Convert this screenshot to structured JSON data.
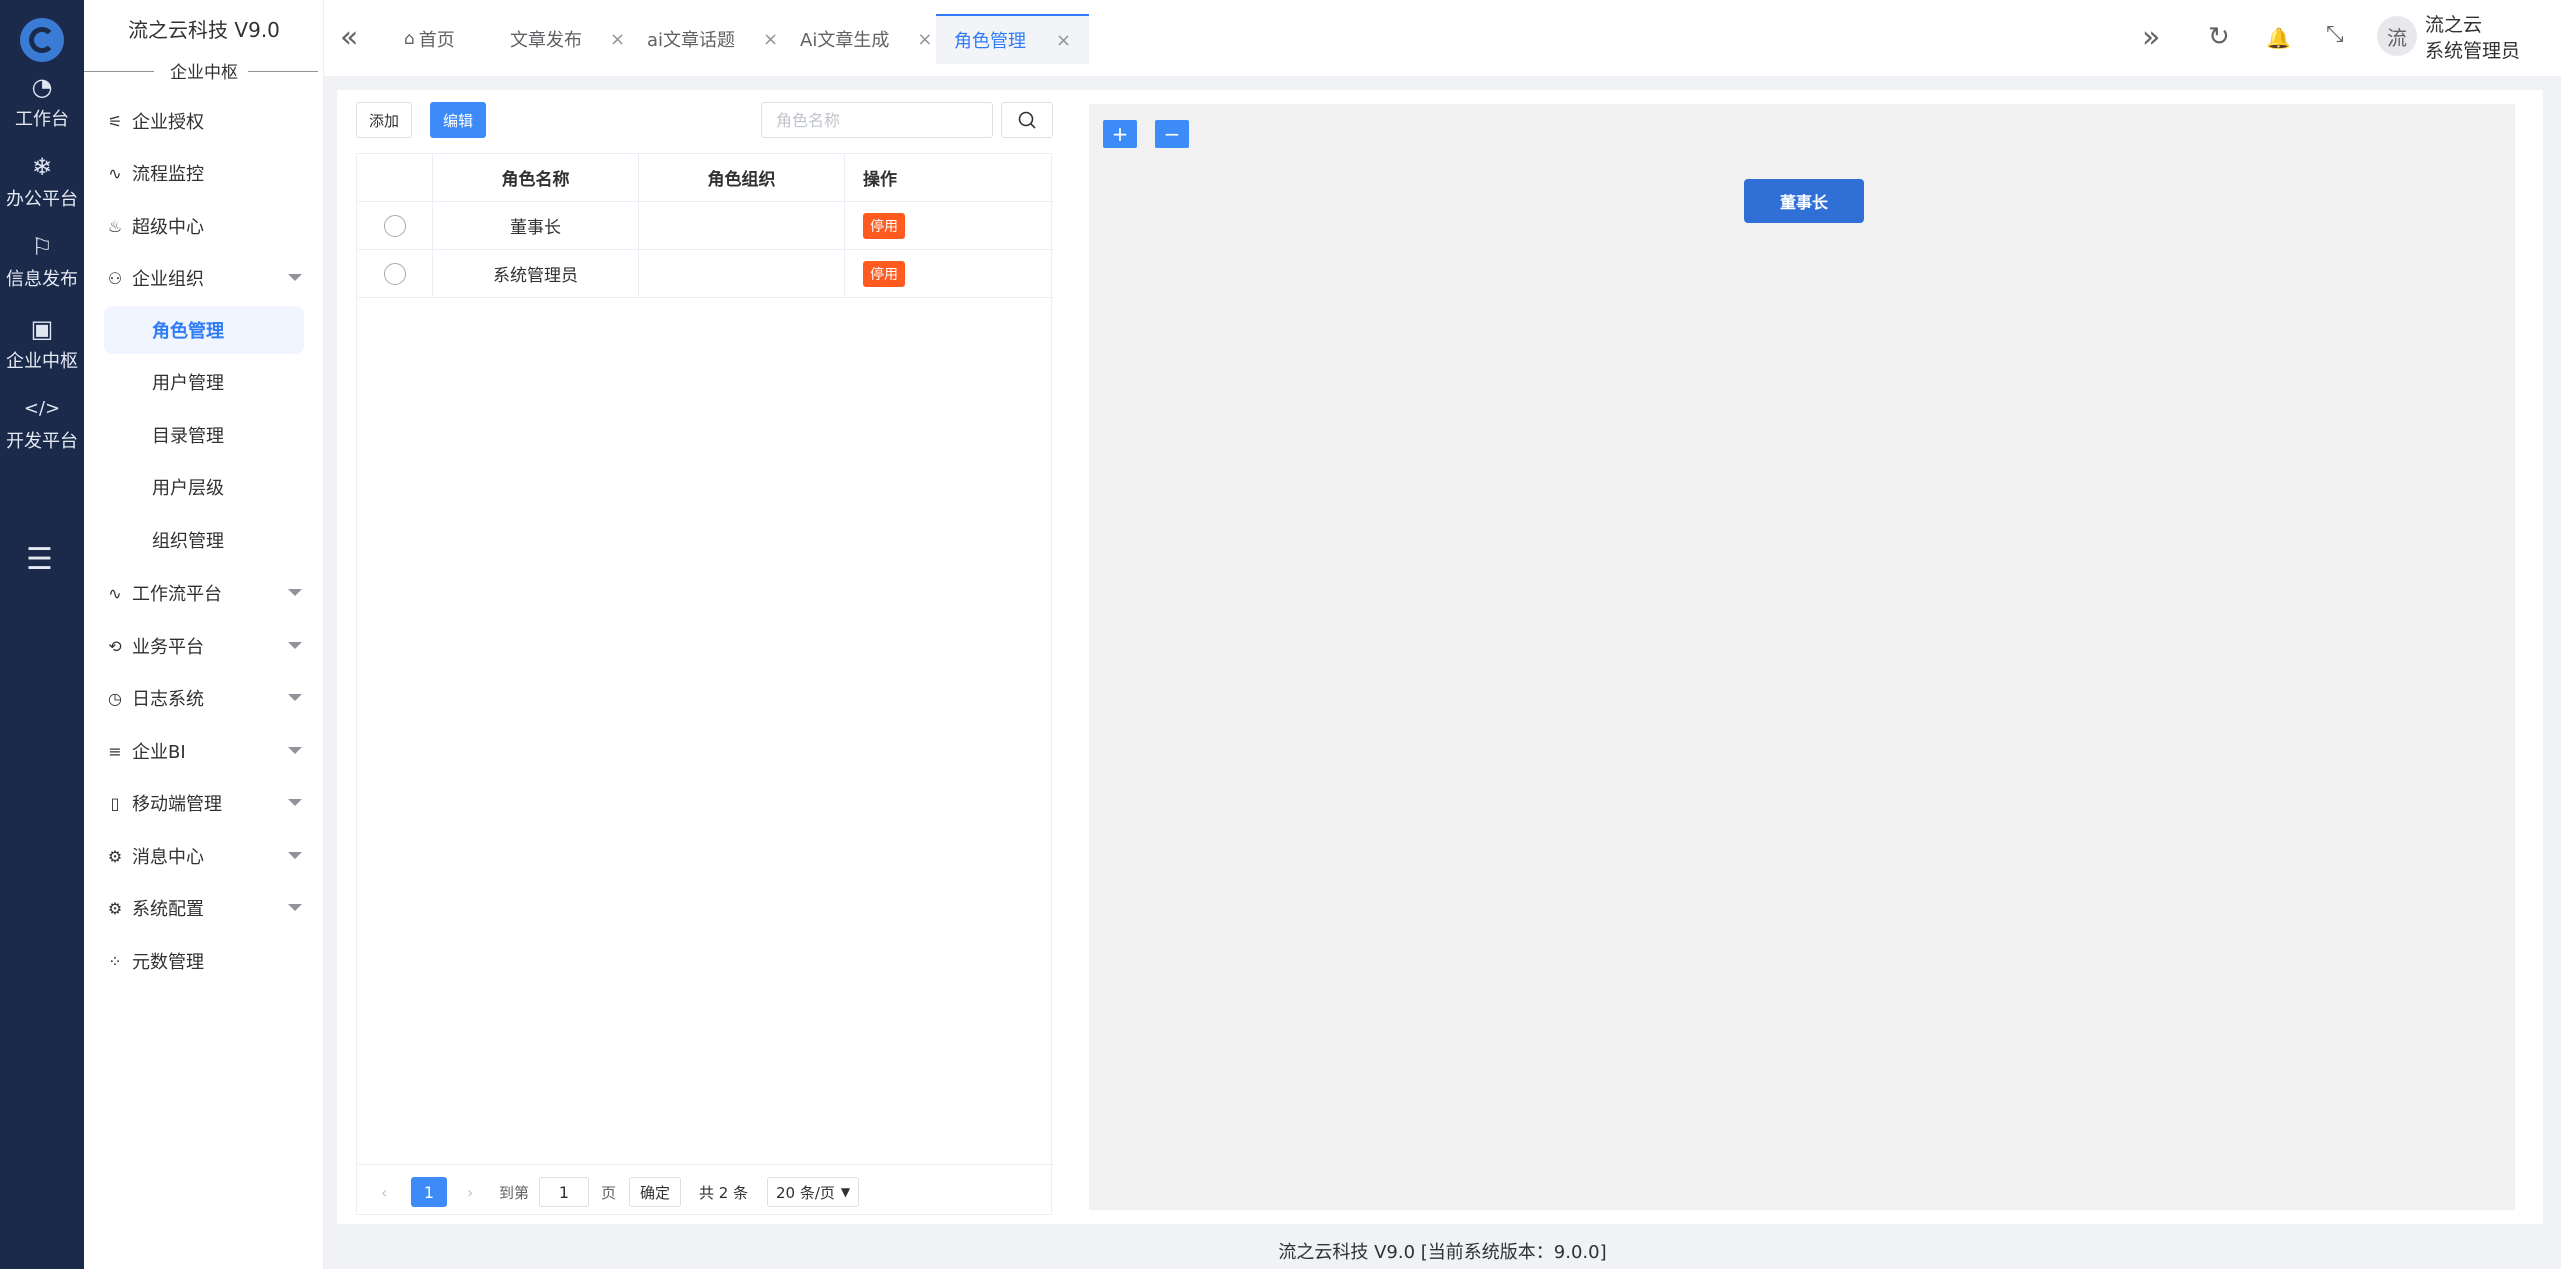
{
  "rail": {
    "items": [
      {
        "label": "工作台",
        "icon": "dashboard-icon",
        "glyph": "◔"
      },
      {
        "label": "办公平台",
        "icon": "snowflake-icon",
        "glyph": "❄"
      },
      {
        "label": "信息发布",
        "icon": "flag-icon",
        "glyph": "⚐"
      },
      {
        "label": "企业中枢",
        "icon": "apps-icon",
        "glyph": "▣"
      },
      {
        "label": "开发平台",
        "icon": "code-icon",
        "glyph": "</>"
      }
    ],
    "fold_icon": "☰"
  },
  "sidebar": {
    "brand": "流之云科技 V9.0",
    "section": "企业中枢",
    "menu": [
      {
        "label": "企业授权",
        "glyph": "⚟",
        "caret": false
      },
      {
        "label": "流程监控",
        "glyph": "∿",
        "caret": false
      },
      {
        "label": "超级中心",
        "glyph": "♨",
        "caret": false
      },
      {
        "label": "企业组织",
        "glyph": "⚇",
        "caret": true
      }
    ],
    "submenu": [
      "角色管理",
      "用户管理",
      "目录管理",
      "用户层级",
      "组织管理"
    ],
    "menu2": [
      {
        "label": "工作流平台",
        "glyph": "∿",
        "caret": true
      },
      {
        "label": "业务平台",
        "glyph": "⟲",
        "caret": true
      },
      {
        "label": "日志系统",
        "glyph": "◷",
        "caret": true
      },
      {
        "label": "企业BI",
        "glyph": "≡",
        "caret": true
      },
      {
        "label": "移动端管理",
        "glyph": "▯",
        "caret": true
      },
      {
        "label": "消息中心",
        "glyph": "⚙",
        "caret": true
      },
      {
        "label": "系统配置",
        "glyph": "⚙",
        "caret": true
      },
      {
        "label": "元数管理",
        "glyph": "⁘",
        "caret": false
      }
    ]
  },
  "topbar": {
    "collapse_glyph": "«",
    "tabs": [
      {
        "label": "首页",
        "closable": false
      },
      {
        "label": "文章发布",
        "closable": true
      },
      {
        "label": "ai文章话题",
        "closable": true
      },
      {
        "label": "Ai文章生成",
        "closable": true
      },
      {
        "label": "角色管理",
        "closable": true,
        "active": true
      }
    ],
    "close_glyph": "×",
    "more_glyph": "»",
    "refresh_glyph": "↻",
    "bell_glyph": "🔔",
    "fullscreen_glyph": "⤡",
    "avatar_text": "流",
    "user_line1": "流之云",
    "user_line2": "系统管理员"
  },
  "role_panel": {
    "add_label": "添加",
    "edit_label": "编辑",
    "search_placeholder": "角色名称",
    "columns": [
      "角色名称",
      "角色组织",
      "操作"
    ],
    "rows": [
      {
        "name": "董事长",
        "org": "",
        "action": "停用"
      },
      {
        "name": "系统管理员",
        "org": "",
        "action": "停用"
      }
    ],
    "pager": {
      "current": "1",
      "goto_label": "到第",
      "goto_value": "1",
      "page_unit": "页",
      "confirm": "确定",
      "total": "共 2 条",
      "page_size": "20 条/页"
    }
  },
  "org_chart": {
    "zoom_in": "+",
    "zoom_out": "−",
    "root_node": "董事长"
  },
  "footer": {
    "text": "流之云科技 V9.0 [当前系统版本：9.0.0]"
  },
  "colors": {
    "rail_bg": "#1b2a4a",
    "accent": "#3d8bf8",
    "danger_tag": "#ff5a1f",
    "node": "#2f6fd6"
  }
}
